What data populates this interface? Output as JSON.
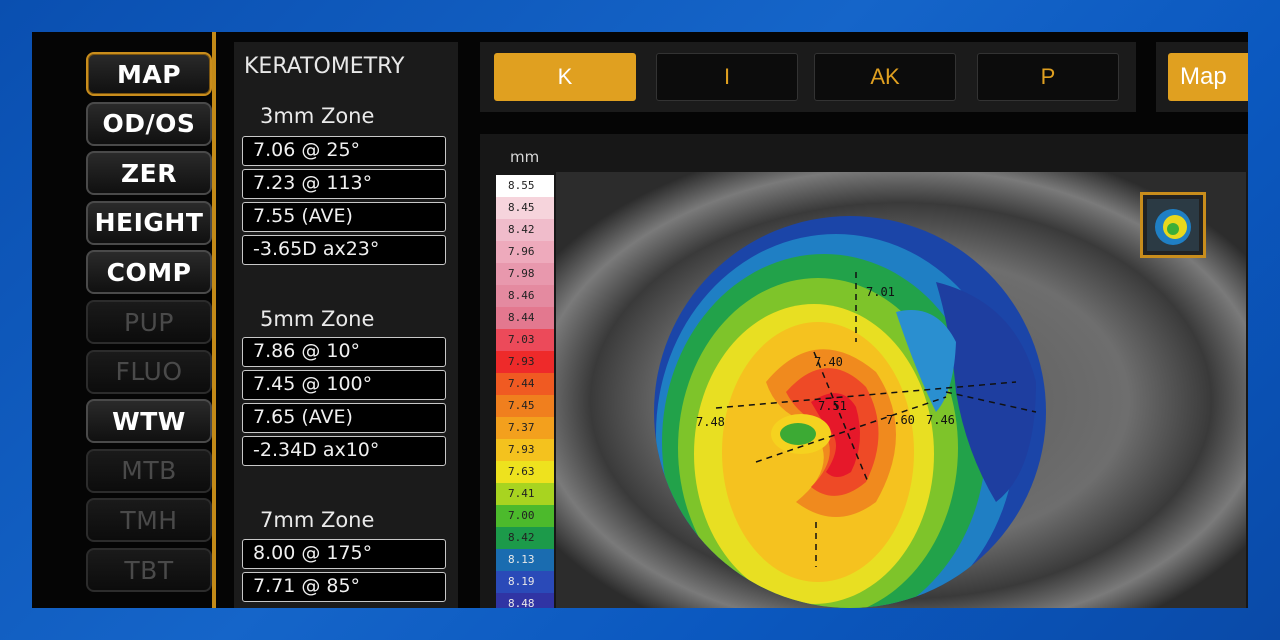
{
  "modes": [
    {
      "label": "MAP",
      "state": "active"
    },
    {
      "label": "OD/OS",
      "state": "normal"
    },
    {
      "label": "ZER",
      "state": "normal"
    },
    {
      "label": "HEIGHT",
      "state": "normal"
    },
    {
      "label": "COMP",
      "state": "normal"
    },
    {
      "label": "PUP",
      "state": "disabled"
    },
    {
      "label": "FLUO",
      "state": "disabled"
    },
    {
      "label": "WTW",
      "state": "normal"
    },
    {
      "label": "MTB",
      "state": "disabled"
    },
    {
      "label": "TMH",
      "state": "disabled"
    },
    {
      "label": "TBT",
      "state": "disabled"
    }
  ],
  "keratometry": {
    "title": "KERATOMETRY",
    "zones": [
      {
        "name": "3mm Zone",
        "rows": [
          "7.06  @ 25°",
          "7.23  @ 113°",
          "7.55 (AVE)",
          "-3.65D ax23°"
        ]
      },
      {
        "name": "5mm Zone",
        "rows": [
          "7.86  @ 10°",
          "7.45  @ 100°",
          "7.65 (AVE)",
          "-2.34D ax10°"
        ]
      },
      {
        "name": "7mm Zone",
        "rows": [
          "8.00  @ 175°",
          "7.71  @ 85°"
        ]
      }
    ]
  },
  "tabs": [
    {
      "label": "K",
      "active": true
    },
    {
      "label": "I",
      "active": false
    },
    {
      "label": "AK",
      "active": false
    },
    {
      "label": "P",
      "active": false
    }
  ],
  "map_button": "Map",
  "map": {
    "unit_label": "mm",
    "scale_values": [
      "8.55",
      "8.45",
      "8.42",
      "7.96",
      "7.98",
      "8.46",
      "8.44",
      "7.03",
      "7.93",
      "7.44",
      "7.45",
      "7.37",
      "7.93",
      "7.63",
      "7.41",
      "7.00",
      "8.42",
      "8.13",
      "8.19",
      "8.48"
    ],
    "scale_colors": [
      "#ffffff",
      "#f6d4dc",
      "#f0bccb",
      "#eeaabc",
      "#e898ad",
      "#e48aa0",
      "#e3788f",
      "#ec4a5a",
      "#ee2a2a",
      "#f05a22",
      "#f07f1e",
      "#f3a01d",
      "#f4c21e",
      "#eee21e",
      "#a8d420",
      "#4cba2c",
      "#1c9a4a",
      "#1a6cb0",
      "#2a4ab8",
      "#3034a4"
    ],
    "annotations": [
      "7.01",
      "7.40",
      "7.51",
      "7.48",
      "7.60",
      "7.46"
    ]
  },
  "colors": {
    "accent": "#e0a020",
    "panel": "#1b1b1b"
  }
}
